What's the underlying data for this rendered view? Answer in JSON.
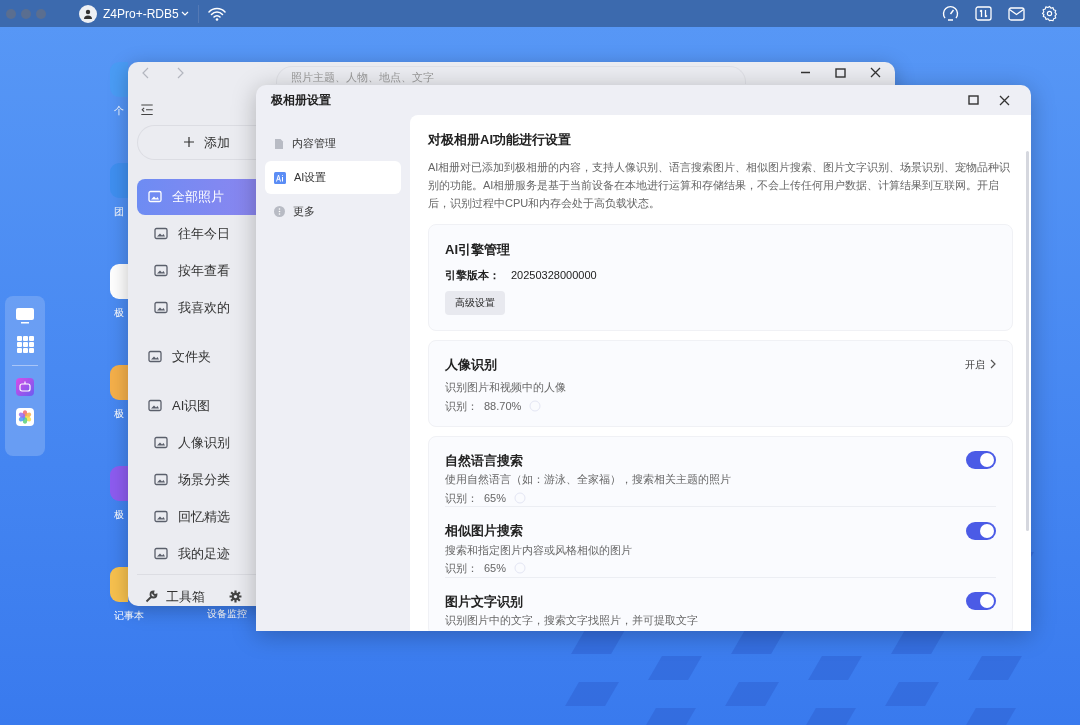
{
  "top_bar": {
    "device": "Z4Pro+-RDB5"
  },
  "desktop_icons": [
    {
      "label": "个"
    },
    {
      "label": "团"
    },
    {
      "label": "极"
    },
    {
      "label": "极"
    },
    {
      "label": "极"
    },
    {
      "label": "记事本"
    }
  ],
  "desktop_labels_col2": [
    "设备监控"
  ],
  "photo_window": {
    "search_placeholder": "照片主题、人物、地点、文字",
    "add_label": "添加",
    "nav": [
      {
        "label": "全部照片",
        "selected": true,
        "children": [
          {
            "label": "往年今日",
            "selected": false
          },
          {
            "label": "按年查看",
            "selected": false
          },
          {
            "label": "我喜欢的",
            "selected": false
          }
        ]
      },
      {
        "label": "文件夹",
        "selected": false
      },
      {
        "label": "AI识图",
        "selected": false,
        "children": [
          {
            "label": "人像识别",
            "selected": false
          },
          {
            "label": "场景分类",
            "selected": false
          },
          {
            "label": "回忆精选",
            "selected": false
          },
          {
            "label": "我的足迹",
            "selected": false
          }
        ]
      }
    ],
    "footer": [
      "工具箱"
    ]
  },
  "settings_window": {
    "title": "极相册设置",
    "nav": [
      {
        "label": "内容管理",
        "selected": false
      },
      {
        "label": "AI设置",
        "selected": true
      },
      {
        "label": "更多",
        "selected": false
      }
    ],
    "heading": "对极相册AI功能进行设置",
    "description": "AI相册对已添加到极相册的内容，支持人像识别、语言搜索图片、相似图片搜索、图片文字识别、场景识别、宠物品种识别的功能。AI相册服务是基于当前设备在本地进行运算和存储结果，不会上传任何用户数据、计算结果到互联网。开启后，识别过程中CPU和内存会处于高负载状态。",
    "engine": {
      "title": "AI引擎管理",
      "version_label": "引擎版本：",
      "version": "20250328000000",
      "button": "高级设置"
    },
    "face": {
      "title": "人像识别",
      "action": "开启",
      "description": "识别图片和视频中的人像",
      "rate_label": "识别：",
      "rate": "88.70%"
    },
    "features": [
      {
        "title": "自然语言搜索",
        "description": "使用自然语言（如：游泳、全家福），搜索相关主题的照片",
        "on": true,
        "rate_label": "识别：",
        "rate": "65%"
      },
      {
        "title": "相似图片搜索",
        "description": "搜索和指定图片内容或风格相似的图片",
        "on": true,
        "rate_label": "识别：",
        "rate": "65%"
      },
      {
        "title": "图片文字识别",
        "description": "识别图片中的文字，搜索文字找照片，并可提取文字",
        "on": true
      }
    ]
  }
}
